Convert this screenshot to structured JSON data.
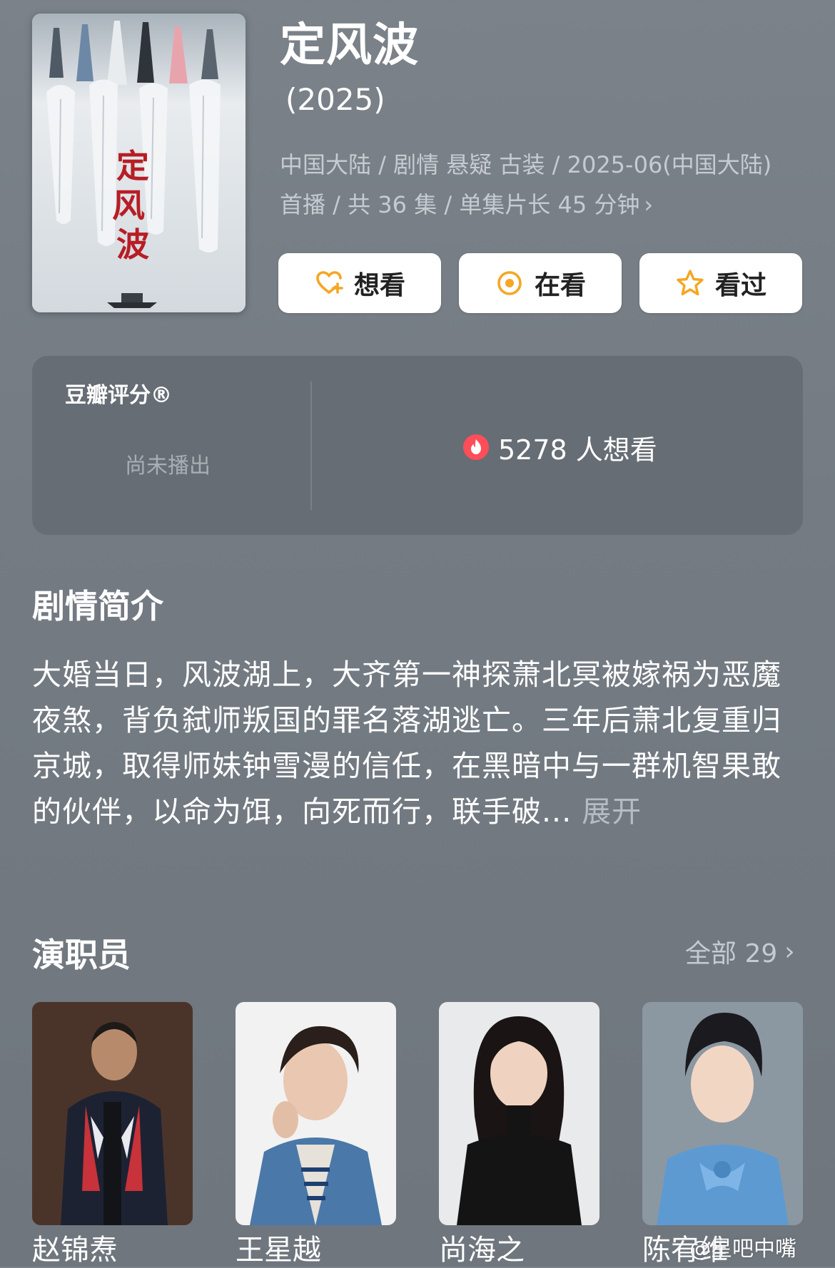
{
  "header": {
    "title": "定风波",
    "year": "(2025)",
    "meta_line1": "中国大陆 / 剧情 悬疑 古装 / 2025-06(中国大陆)",
    "meta_line2": "首播 / 共 36 集 / 单集片长 45 分钟",
    "meta_chevron": "›"
  },
  "poster": {
    "title_glyphs": "定风波",
    "icon": "poster-image"
  },
  "actions": [
    {
      "label": "想看",
      "icon": "heart-plus-icon"
    },
    {
      "label": "在看",
      "icon": "target-circle-icon"
    },
    {
      "label": "看过",
      "icon": "star-outline-icon"
    }
  ],
  "rating": {
    "title": "豆瓣评分®",
    "status": "尚未播出",
    "wish_text": "5278 人想看",
    "wish_icon": "flame-icon"
  },
  "synopsis": {
    "heading": "剧情简介",
    "text": "大婚当日，风波湖上，大齐第一神探萧北冥被嫁祸为恶魔夜煞，背负弑师叛国的罪名落湖逃亡。三年后萧北复重归京城，取得师妹钟雪漫的信任，在黑暗中与一群机智果敢的伙伴，以命为饵，向死而行，联手破...",
    "more": " 展开"
  },
  "cast": {
    "heading": "演职员",
    "all_label": "全部 29",
    "chevron": "›",
    "members": [
      {
        "name": "赵锦焘"
      },
      {
        "name": "王星越"
      },
      {
        "name": "尚海之"
      },
      {
        "name": "陈宥维"
      }
    ]
  },
  "watermark": "@星吧中嘴",
  "colors": {
    "background": "#757c84",
    "card": "#666d74",
    "button_bg": "#ffffff",
    "accent_orange": "#f5a623",
    "flame_red": "#ff4d5a"
  }
}
